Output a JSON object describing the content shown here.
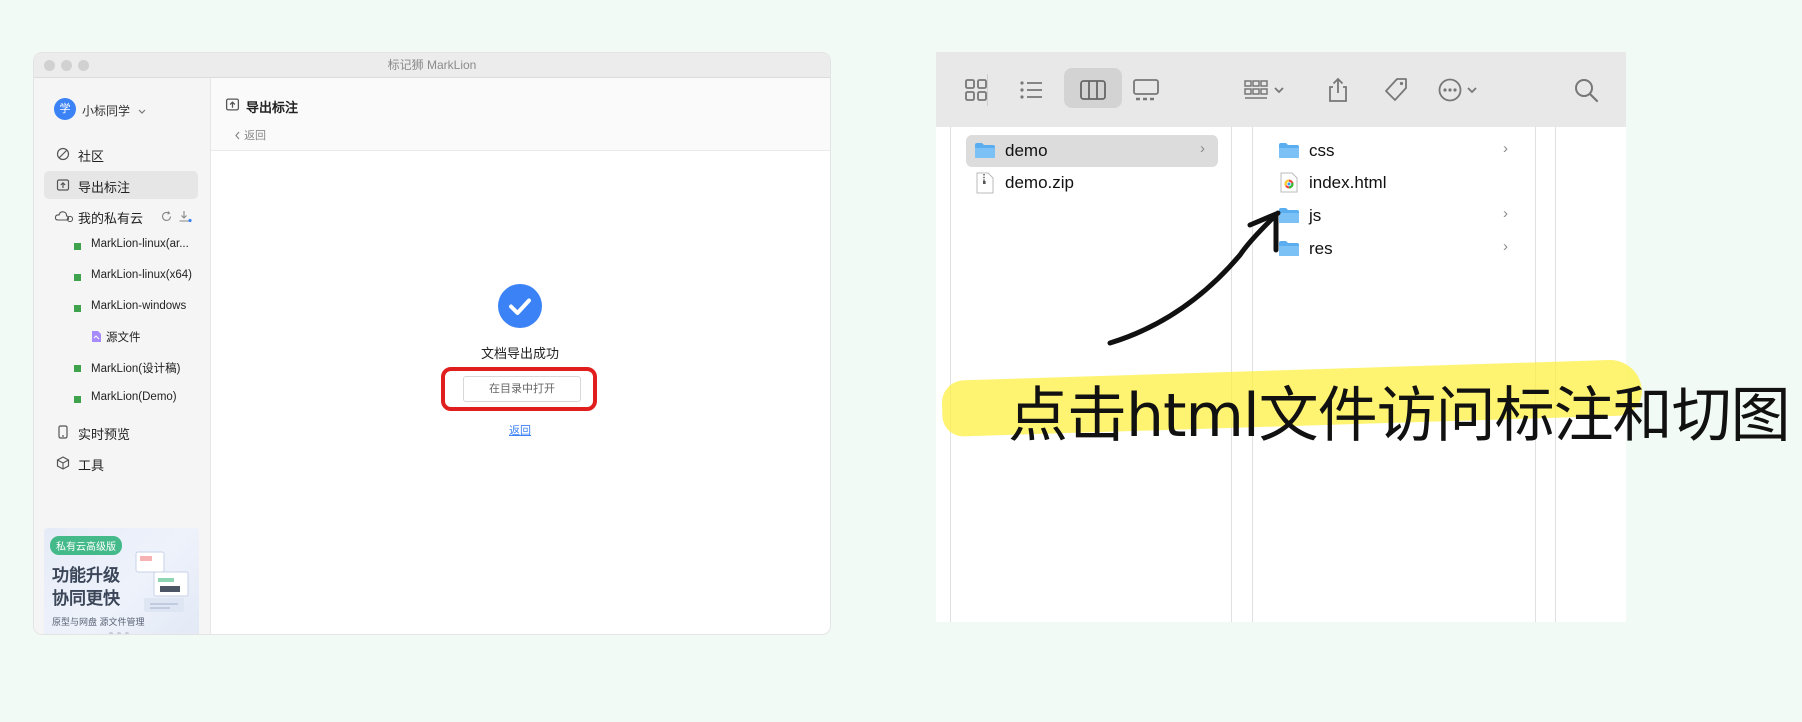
{
  "app": {
    "title": "标记狮 MarkLion",
    "user": {
      "avatar": "学",
      "name": "小标同学"
    },
    "sidebar": {
      "items": [
        {
          "label": "社区",
          "icon": "community-icon"
        },
        {
          "label": "导出标注",
          "icon": "export-icon",
          "active": true
        },
        {
          "label": "我的私有云",
          "icon": "cloud-icon"
        }
      ],
      "cloud_items": [
        "MarkLion-linux(ar...",
        "MarkLion-linux(x64)",
        "MarkLion-windows"
      ],
      "source_file": "源文件",
      "cloud_items_2": [
        "MarkLion(设计稿)",
        "MarkLion(Demo)"
      ],
      "items_bottom": [
        {
          "label": "实时预览",
          "icon": "preview-icon"
        },
        {
          "label": "工具",
          "icon": "tools-icon"
        }
      ],
      "promo": {
        "tag": "私有云高级版",
        "headline_1": "功能升级",
        "headline_2": "协同更快",
        "sub": "原型与网盘   源文件管理"
      }
    },
    "main": {
      "title": "导出标注",
      "back": "返回",
      "success": "文档导出成功",
      "open_button": "在目录中打开",
      "return_link": "返回"
    }
  },
  "finder": {
    "column1": [
      {
        "name": "demo",
        "type": "folder",
        "selected": true
      },
      {
        "name": "demo.zip",
        "type": "zip"
      }
    ],
    "column2": [
      {
        "name": "css",
        "type": "folder"
      },
      {
        "name": "index.html",
        "type": "html"
      },
      {
        "name": "js",
        "type": "folder"
      },
      {
        "name": "res",
        "type": "folder"
      }
    ]
  },
  "annotation": {
    "text": "点击html文件访问标注和切图",
    "highlight_color": "#fff03c"
  },
  "colors": {
    "accent": "#3b82f6",
    "red_box": "#e01e1e",
    "sidebar_green": "#3fa34d"
  }
}
